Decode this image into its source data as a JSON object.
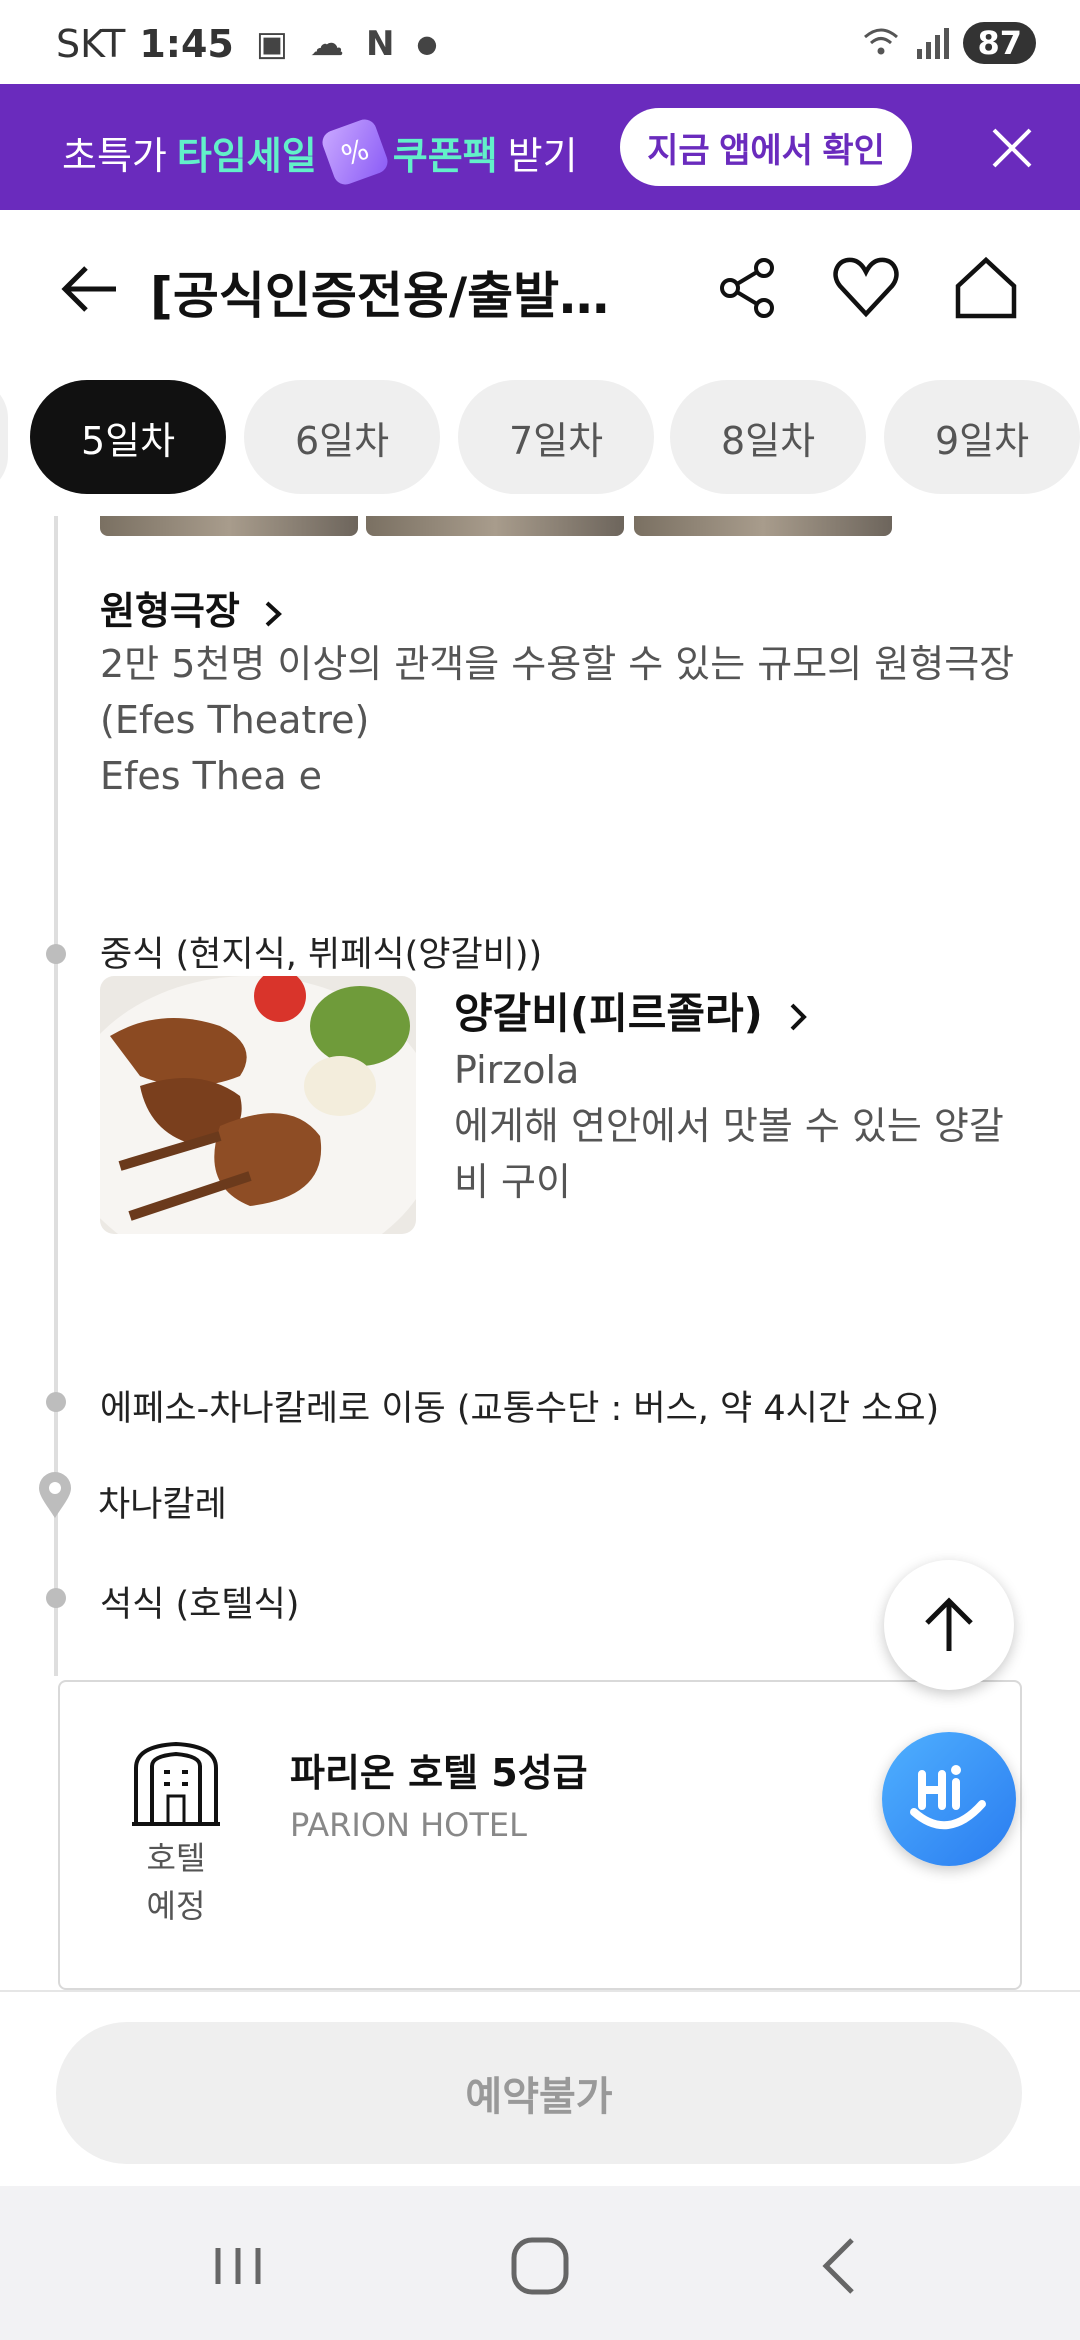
{
  "status_bar": {
    "carrier": "SKT",
    "time": "1:45",
    "battery": "87",
    "icons": [
      "screenshot-icon",
      "cloud-icon",
      "naver-icon",
      "dot-icon",
      "wifi-icon",
      "signal-icon"
    ]
  },
  "promo": {
    "prefix": "초특가",
    "highlight1": "타임세일",
    "highlight2": "쿠폰팩",
    "suffix": "받기",
    "button": "지금 앱에서 확인",
    "colors": {
      "background": "#6a2bbd",
      "highlight": "#62f0c9"
    }
  },
  "header": {
    "title": "[공식인증전용/출발확..."
  },
  "tabs": [
    {
      "label": "5일차",
      "active": true
    },
    {
      "label": "6일차",
      "active": false
    },
    {
      "label": "7일차",
      "active": false
    },
    {
      "label": "8일차",
      "active": false
    },
    {
      "label": "9일차",
      "active": false
    }
  ],
  "attraction": {
    "title": "원형극장",
    "description": "2만 5천명 이상의 관객을 수용할 수 있는 규모의 원형극장",
    "description_en": "(Efes Theatre)",
    "extra": "Efes Thea e"
  },
  "meal": {
    "label": "중식 (현지식, 뷔페식(양갈비))",
    "name": "양갈비(피르졸라)",
    "name_en": "Pirzola",
    "description": "에게해 연안에서 맛볼 수 있는 양갈비 구이"
  },
  "move": {
    "text": "에페소-차나칼레로 이동 (교통수단 : 버스, 약 4시간 소요)"
  },
  "city": {
    "name": "차나칼레"
  },
  "dinner": {
    "text": "석식 (호텔식)"
  },
  "hotel": {
    "status_line1": "호텔",
    "status_line2": "예정",
    "name": "파리온 호텔 5성급",
    "name_en": "PARION HOTEL"
  },
  "bottom": {
    "reserve_label": "예약불가"
  }
}
